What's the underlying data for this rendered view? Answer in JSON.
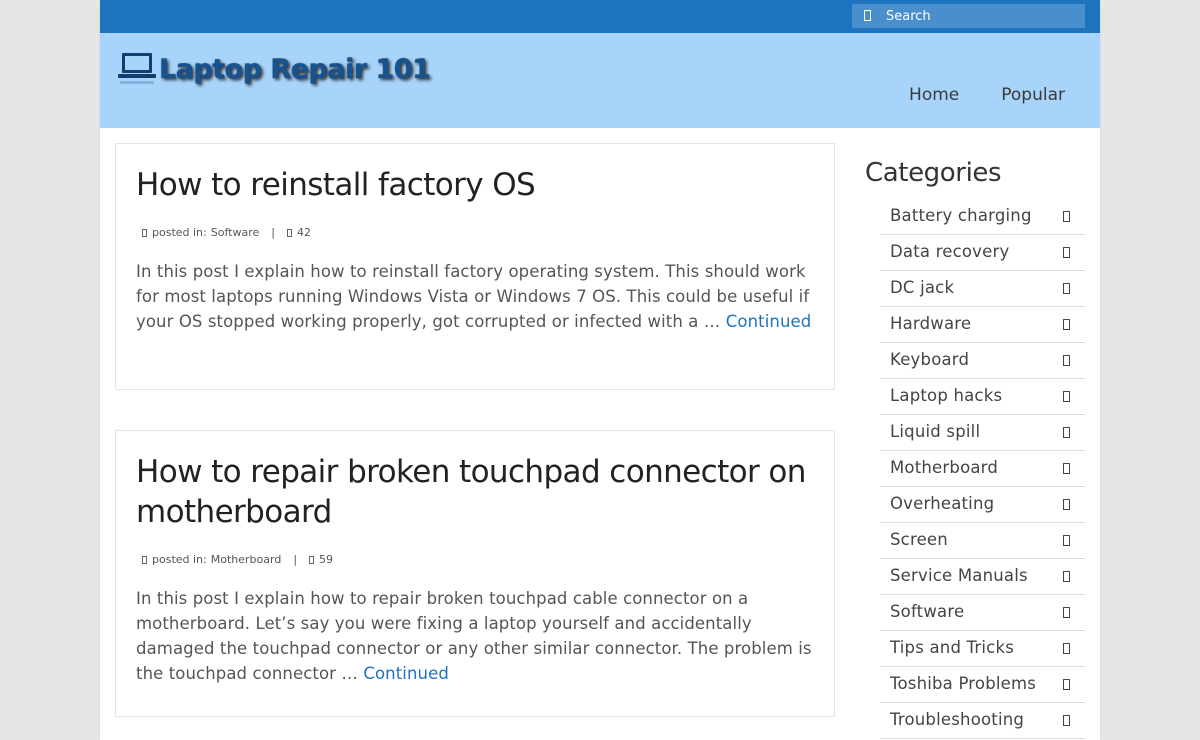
{
  "search": {
    "placeholder": "Search",
    "icon": "search-icon"
  },
  "header": {
    "logo_text": "Laptop Repair 101",
    "logo_icon": "laptop-icon",
    "nav": [
      {
        "label": "Home"
      },
      {
        "label": "Popular"
      }
    ]
  },
  "posts": [
    {
      "title": "How to reinstall factory OS",
      "posted_in_label": "posted in:",
      "category": "Software",
      "comments": "42",
      "excerpt": "In this post I explain how to reinstall factory operating system. This should work for most laptops running Windows Vista or Windows 7 OS. This could be useful if your OS stopped working properly, got corrupted or infected with a …",
      "continue_label": "Continued"
    },
    {
      "title": "How to repair broken touchpad connector on motherboard",
      "posted_in_label": "posted in:",
      "category": "Motherboard",
      "comments": "59",
      "excerpt": "In this post I explain how to repair broken touchpad cable connector on a motherboard. Let’s say you were fixing a laptop yourself and accidentally damaged the touchpad connector or any other similar connector. The problem is the touchpad connector …",
      "continue_label": "Continued"
    }
  ],
  "sidebar": {
    "heading": "Categories",
    "items": [
      {
        "label": "Battery charging"
      },
      {
        "label": "Data recovery"
      },
      {
        "label": "DC jack"
      },
      {
        "label": "Hardware"
      },
      {
        "label": "Keyboard"
      },
      {
        "label": "Laptop hacks"
      },
      {
        "label": "Liquid spill"
      },
      {
        "label": "Motherboard"
      },
      {
        "label": "Overheating"
      },
      {
        "label": "Screen"
      },
      {
        "label": "Service Manuals"
      },
      {
        "label": "Software"
      },
      {
        "label": "Tips and Tricks"
      },
      {
        "label": "Toshiba Problems"
      },
      {
        "label": "Troubleshooting"
      }
    ]
  },
  "colors": {
    "topbar": "#1e73be",
    "header": "#a8d4fb",
    "link": "#1e73be",
    "logo_text": "#155491"
  }
}
